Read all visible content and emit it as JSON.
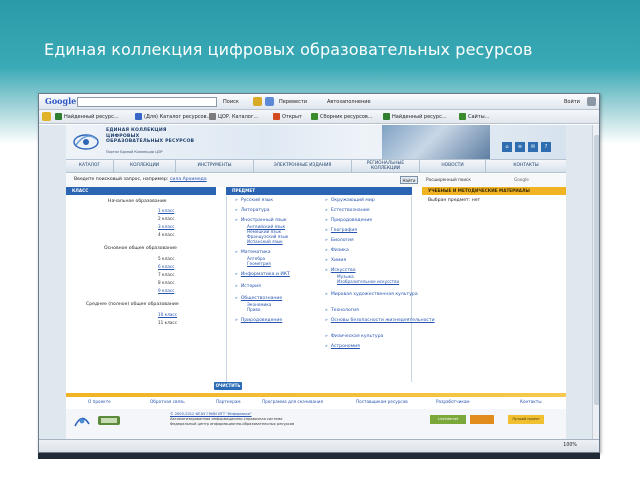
{
  "slide": {
    "title": "Единая коллекция цифровых образовательных ресурсов"
  },
  "browser": {
    "search_brand": "Google",
    "search_value": "",
    "toolbar": {
      "search_btn": "Поиск",
      "go_label": "Перевести",
      "autofill": "Автозаполнение",
      "signin": "Войти"
    },
    "bookmarks": [
      {
        "label": "Найденный ресурс...",
        "color": "#2f7d2f"
      },
      {
        "label": "(Для) Каталог ресурсов...",
        "color": "#3867c7"
      },
      {
        "label": "ЦОР. Каталог...",
        "color": "#7b7b7b"
      },
      {
        "label": "Открыт",
        "color": "#d14b1e"
      },
      {
        "label": "Сборник ресурсов...",
        "color": "#3a8b2b"
      },
      {
        "label": "Найденный ресурс...",
        "color": "#2f7d2f"
      },
      {
        "label": "Сайты...",
        "color": "#3a8b2b"
      }
    ],
    "status": {
      "zoom": "100%"
    }
  },
  "site": {
    "name_lines": [
      "ЕДИНАЯ КОЛЛЕКЦИЯ",
      "ЦИФРОВЫХ",
      "ОБРАЗОВАТЕЛЬНЫХ РЕСУРСОВ"
    ],
    "subtitle": "Портал Единой Коллекции ЦОР",
    "nav": [
      "КАТАЛОГ",
      "КОЛЛЕКЦИИ",
      "ИНСТРУМЕНТЫ",
      "ЭЛЕКТРОННЫЕ ИЗДАНИЯ",
      "РЕГИОНАЛЬНЫЕ КОЛЛЕКЦИИ",
      "НОВОСТИ",
      "КОНТАКТЫ"
    ],
    "search": {
      "label": "Введите поисковый запрос, например:",
      "example": "сила Архимеда",
      "button": "Найти",
      "extended": "Расширенный поиск",
      "google": "Google"
    },
    "columns": {
      "class_head": "КЛАСС",
      "subject_head": "ПРЕДМЕТ",
      "materials_head": "УЧЕБНЫЕ И МЕТОДИЧЕСКИЕ МАТЕРИАЛЫ",
      "selected_label": "Выбран предмет: нет"
    },
    "levels": [
      {
        "title": "Начальное образование",
        "grades": [
          "1 класс",
          "2 класс",
          "3 класс",
          "4 класс"
        ]
      },
      {
        "title": "Основное общее образование",
        "grades": [
          "5 класс",
          "6 класс",
          "7 класс",
          "8 класс",
          "9 класс"
        ]
      },
      {
        "title": "Среднее (полное) общее образование",
        "grades": [
          "10 класс",
          "11 класс"
        ]
      }
    ],
    "subjects_left": [
      "Русский язык",
      "Литература",
      "Иностранный язык",
      "Математика",
      "Информатика и ИКТ",
      "История",
      "Обществознание",
      "Природоведение"
    ],
    "foreign_sub": [
      "Английский язык",
      "Немецкий язык",
      "Французский язык",
      "Испанский язык"
    ],
    "math_sub": [
      "Алгебра",
      "Геометрия"
    ],
    "social_sub": [
      "Экономика",
      "Право"
    ],
    "subjects_right": [
      "Окружающий мир",
      "Естествознание",
      "Природоведение",
      "География",
      "Биология",
      "Физика",
      "Химия",
      "Искусство",
      "Мировая художественная культура",
      "Технология",
      "Основы безопасности жизнедеятельности",
      "Физическая культура",
      "Астрономия"
    ],
    "art_sub": [
      "Музыка",
      "Изобразительное искусство"
    ],
    "clear_btn": "ОЧИСТИТЬ",
    "footer_links": [
      "О проекте",
      "Обратная связь",
      "Партнерам",
      "Программа для скачивания",
      "Поставщикам ресурсов",
      "Разработчикам",
      "Контакты"
    ],
    "copyright": [
      "© 2005-2012 ФГАУ ГНИИ ИТТ \"Информика\"",
      "Автоматизированная информационно-справочная система",
      "Федеральный центр информационно-образовательных ресурсов"
    ],
    "badge_left": "LiveInternet",
    "badge_right": "Лучший проект"
  }
}
